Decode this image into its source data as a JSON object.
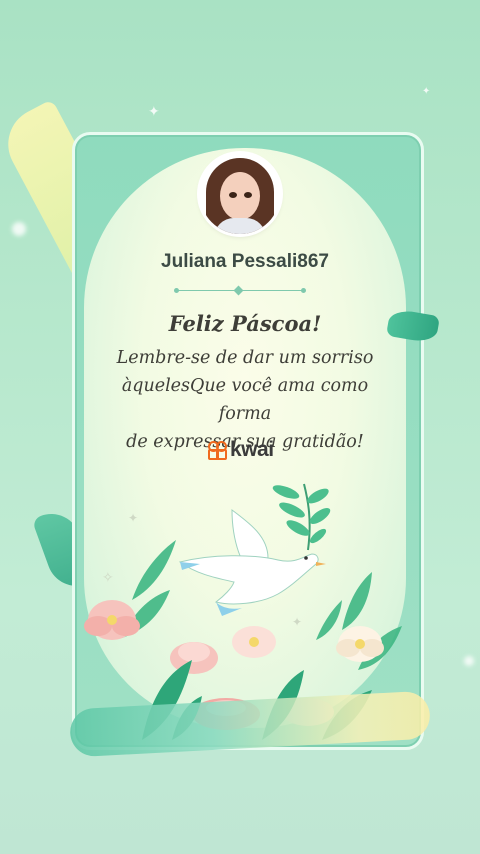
{
  "card": {
    "username": "Juliana Pessali867",
    "title": "Feliz Páscoa!",
    "message_lines": [
      "Lembre-se de dar um sorriso",
      "àquelesQue você ama como forma",
      "de expressar sua gratidão!"
    ],
    "brand": "kwai"
  },
  "icons": {
    "avatar": "user-avatar",
    "brand": "kwai-logo-icon",
    "dove": "dove-illustration",
    "flowers": "flower-illustration"
  },
  "colors": {
    "background": "#b7e8cd",
    "card_border": "#e9fbf1",
    "text": "#3e3e38",
    "brand_orange": "#f06a1e"
  }
}
